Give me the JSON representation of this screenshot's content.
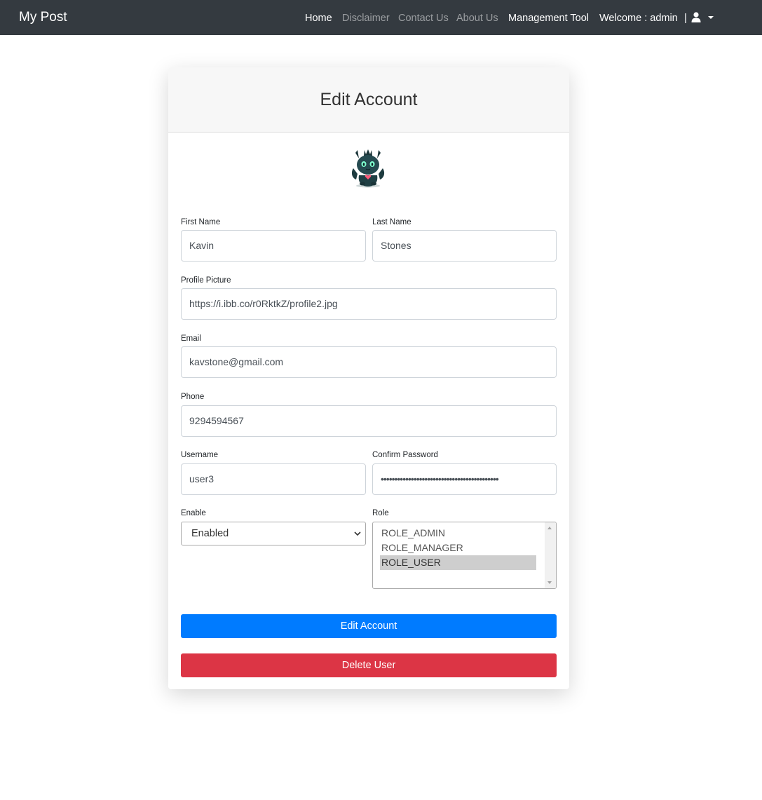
{
  "navbar": {
    "brand": "My Post",
    "links": [
      {
        "label": "Home",
        "active": true
      },
      {
        "label": "Disclaimer",
        "active": false
      },
      {
        "label": "Contact Us",
        "active": false
      },
      {
        "label": "About Us",
        "active": false
      },
      {
        "label": "Management Tool",
        "active": true
      }
    ],
    "welcome": "Welcome : admin",
    "separator": "|",
    "user_icon": "user-icon",
    "dropdown_icon": "caret-down-icon"
  },
  "form": {
    "title": "Edit Account",
    "avatar_icon": "dragon-avatar",
    "first_name": {
      "label": "First Name",
      "value": "Kavin"
    },
    "last_name": {
      "label": "Last Name",
      "value": "Stones"
    },
    "profile_picture": {
      "label": "Profile Picture",
      "value": "https://i.ibb.co/r0RktkZ/profile2.jpg"
    },
    "email": {
      "label": "Email",
      "value": "kavstone@gmail.com"
    },
    "phone": {
      "label": "Phone",
      "value": "9294594567"
    },
    "username": {
      "label": "Username",
      "value": "user3"
    },
    "confirm_password": {
      "label": "Confirm Password",
      "value": "•••••••••••••••••••••••••••••••••••••••••••"
    },
    "enable": {
      "label": "Enable",
      "selected": "Enabled"
    },
    "role": {
      "label": "Role",
      "options": [
        "ROLE_ADMIN",
        "ROLE_MANAGER",
        "ROLE_USER"
      ],
      "selected": "ROLE_USER"
    },
    "edit_button": "Edit Account",
    "delete_button": "Delete User"
  },
  "colors": {
    "navbar_bg": "#343a40",
    "primary": "#007bff",
    "danger": "#dc3545"
  }
}
